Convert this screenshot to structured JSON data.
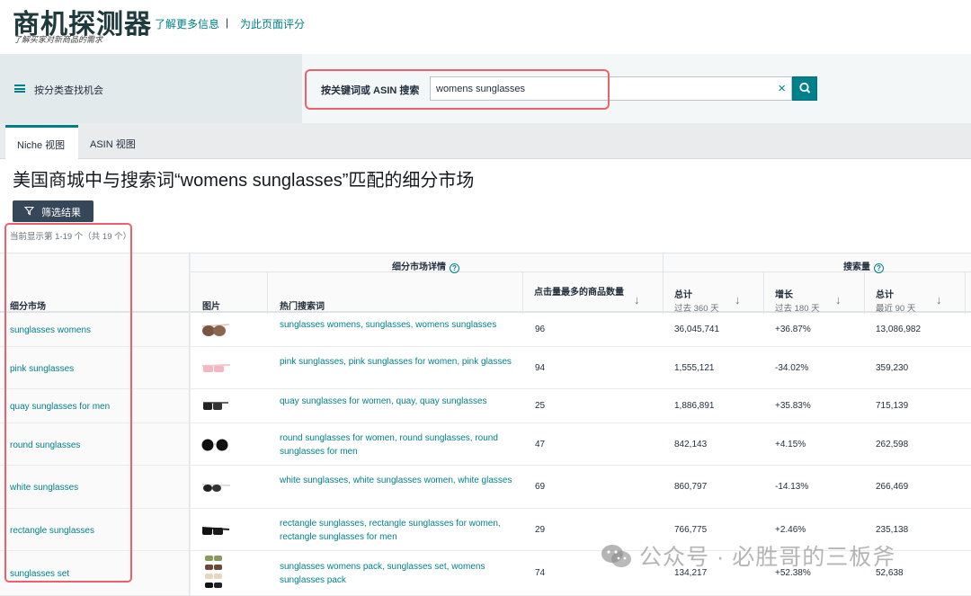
{
  "header": {
    "title": "商机探测器",
    "subtitle": "了解买家对新商品的需求",
    "links": [
      "了解更多信息",
      "为此页面评分"
    ],
    "separator": "|"
  },
  "band": {
    "category_label": "按分类查找机会",
    "search_label": "按关键词或 ASIN 搜索",
    "search_value": "womens sunglasses",
    "clear_icon": "×"
  },
  "tabs": [
    {
      "label": "Niche 视图",
      "active": true
    },
    {
      "label": "ASIN 视图",
      "active": false
    }
  ],
  "page_title": "美国商城中与搜索词“womens sunglasses”匹配的细分市场",
  "filter_label": "筛选结果",
  "result_count": "当前显示第 1-19 个（共 19 个）",
  "table": {
    "group_headers": {
      "details": "细分市场详情",
      "search_volume": "搜索量",
      "help_icon": "?"
    },
    "columns": {
      "niche": "细分市场",
      "image": "图片",
      "keywords": "热门搜索词",
      "top_clicked": "点击量最多的商品数量",
      "total_360": {
        "title": "总计",
        "sub": "过去 360 天"
      },
      "growth_180": {
        "title": "增长",
        "sub": "过去 180 天"
      },
      "total_90": {
        "title": "总计",
        "sub": "最近 90 天"
      }
    },
    "sort_icon": "↓",
    "rows": [
      {
        "niche": "sunglasses womens",
        "image": "brown-sunglasses",
        "keywords": "sunglasses womens, sunglasses, womens sunglasses",
        "top_clicked": "96",
        "total_360": "36,045,741",
        "growth_180": "+36.87%",
        "total_90": "13,086,982"
      },
      {
        "niche": "pink sunglasses",
        "image": "pink-sunglasses",
        "keywords": "pink sunglasses, pink sunglasses for women, pink glasses",
        "top_clicked": "94",
        "total_360": "1,555,121",
        "growth_180": "-34.02%",
        "total_90": "359,230"
      },
      {
        "niche": "quay sunglasses for men",
        "image": "black-sunglasses",
        "keywords": "quay sunglasses for women, quay, quay sunglasses",
        "top_clicked": "25",
        "total_360": "1,886,891",
        "growth_180": "+35.83%",
        "total_90": "715,139"
      },
      {
        "niche": "round sunglasses",
        "image": "round-sunglasses",
        "keywords": "round sunglasses for women, round sunglasses, round sunglasses for men",
        "top_clicked": "47",
        "total_360": "842,143",
        "growth_180": "+4.15%",
        "total_90": "262,598"
      },
      {
        "niche": "white sunglasses",
        "image": "white-sunglasses",
        "keywords": "white sunglasses, white sunglasses women, white glasses",
        "top_clicked": "69",
        "total_360": "860,797",
        "growth_180": "-14.13%",
        "total_90": "266,469"
      },
      {
        "niche": "rectangle sunglasses",
        "image": "rectangle-sunglasses",
        "keywords": "rectangle sunglasses, rectangle sunglasses for women, rectangle sunglasses for men",
        "top_clicked": "29",
        "total_360": "766,775",
        "growth_180": "+2.46%",
        "total_90": "235,138"
      },
      {
        "niche": "sunglasses set",
        "image": "sunglasses-set",
        "keywords": "sunglasses womens pack, sunglasses set, womens sunglasses pack",
        "top_clicked": "74",
        "total_360": "134,217",
        "growth_180": "+52.38%",
        "total_90": "52,638"
      }
    ]
  },
  "watermark": "公众号 · 必胜哥的三板斧",
  "colors": {
    "accent": "#00808b",
    "highlight": "#f0606c",
    "filter_btn": "#37475a"
  }
}
